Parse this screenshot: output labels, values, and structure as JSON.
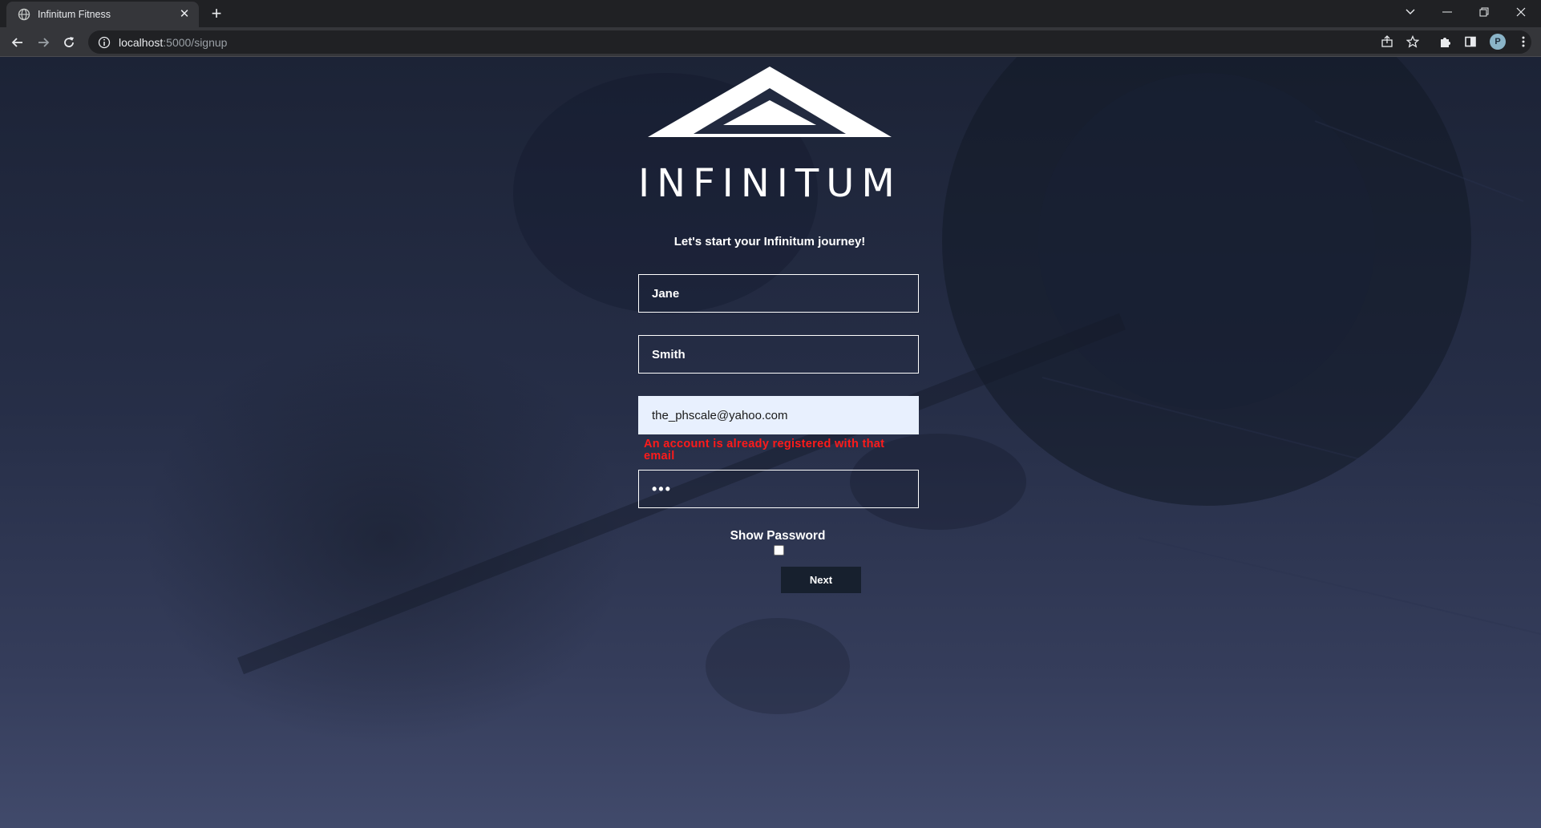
{
  "browser": {
    "tab_title": "Infinitum Fitness",
    "url_host": "localhost",
    "url_rest": ":5000/signup",
    "profile_initial": "P"
  },
  "page": {
    "brand_name": "INFINITUM",
    "tagline": "Let's start your Infinitum journey!",
    "form": {
      "first_name": "Jane",
      "last_name": "Smith",
      "email": "the_phscale@yahoo.com",
      "email_error": "An account is already registered with that email",
      "password_mask": "•••",
      "show_password_label": "Show Password",
      "show_password_checked": false,
      "next_label": "Next"
    },
    "colors": {
      "error": "#ff1a1a",
      "button_bg": "#17202e",
      "autofill_bg": "#e8f0fe"
    }
  }
}
